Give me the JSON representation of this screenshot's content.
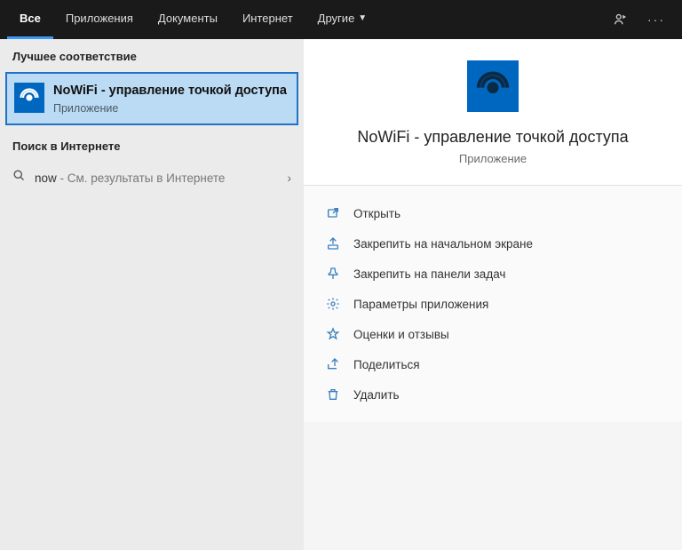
{
  "topbar": {
    "tabs": [
      {
        "label": "Все",
        "active": true
      },
      {
        "label": "Приложения",
        "active": false
      },
      {
        "label": "Документы",
        "active": false
      },
      {
        "label": "Интернет",
        "active": false
      },
      {
        "label": "Другие",
        "active": false,
        "dropdown": true
      }
    ]
  },
  "left": {
    "best_label": "Лучшее соответствие",
    "best": {
      "title": "NoWiFi - управление точкой доступа",
      "subtitle": "Приложение"
    },
    "web_label": "Поиск в Интернете",
    "web": {
      "query": "now",
      "suffix": " - См. результаты в Интернете"
    }
  },
  "preview": {
    "title": "NoWiFi - управление точкой доступа",
    "subtitle": "Приложение",
    "actions": [
      {
        "icon": "open",
        "label": "Открыть"
      },
      {
        "icon": "pin-start",
        "label": "Закрепить на начальном экране"
      },
      {
        "icon": "pin-task",
        "label": "Закрепить на панели задач"
      },
      {
        "icon": "settings",
        "label": "Параметры приложения"
      },
      {
        "icon": "rate",
        "label": "Оценки и отзывы"
      },
      {
        "icon": "share",
        "label": "Поделиться"
      },
      {
        "icon": "delete",
        "label": "Удалить"
      }
    ]
  }
}
